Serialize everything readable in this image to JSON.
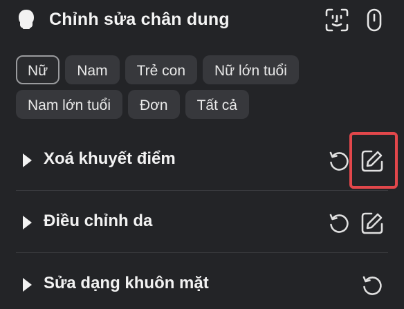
{
  "header": {
    "title": "Chỉnh sửa chân dung"
  },
  "filters": {
    "row1": [
      "Nữ",
      "Nam",
      "Trẻ con",
      "Nữ lớn tuổi"
    ],
    "row2": [
      "Nam lớn tuổi",
      "Đơn",
      "Tất cả"
    ],
    "selected": "Nữ"
  },
  "sections": [
    {
      "label": "Xoá khuyết điểm",
      "has_edit": true,
      "edit_highlighted": true
    },
    {
      "label": "Điều chỉnh da",
      "has_edit": true,
      "edit_highlighted": false
    },
    {
      "label": "Sửa dạng khuôn mặt",
      "has_edit": false,
      "edit_highlighted": false
    }
  ],
  "icons": {
    "header_left": "person-head-icon",
    "face_scan": "face-scan-icon",
    "toggle": "toggle-switch-icon",
    "reset": "reset-icon",
    "edit": "pencil-edit-icon",
    "expand": "caret-right-icon"
  },
  "colors": {
    "background": "#232427",
    "chip": "#37383c",
    "highlight": "#e2474b"
  }
}
